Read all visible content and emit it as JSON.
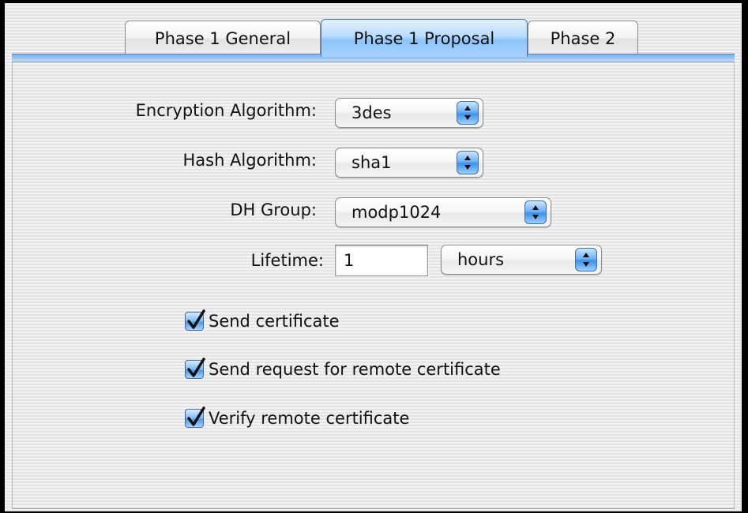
{
  "tabs": [
    {
      "label": "Phase 1 General",
      "active": false
    },
    {
      "label": "Phase 1 Proposal",
      "active": true
    },
    {
      "label": "Phase 2",
      "active": false
    }
  ],
  "form": {
    "encryption_label": "Encryption Algorithm:",
    "encryption_value": "3des",
    "hash_label": "Hash Algorithm:",
    "hash_value": "sha1",
    "dh_label": "DH Group:",
    "dh_value": "modp1024",
    "lifetime_label": "Lifetime:",
    "lifetime_value": "1",
    "lifetime_unit": "hours"
  },
  "checkboxes": [
    {
      "label": "Send certificate",
      "checked": true
    },
    {
      "label": "Send request for remote certificate",
      "checked": true
    },
    {
      "label": "Verify remote certificate",
      "checked": true
    }
  ],
  "colors": {
    "accent": "#6fb2f6",
    "tab_active": "#a8d3fd"
  }
}
